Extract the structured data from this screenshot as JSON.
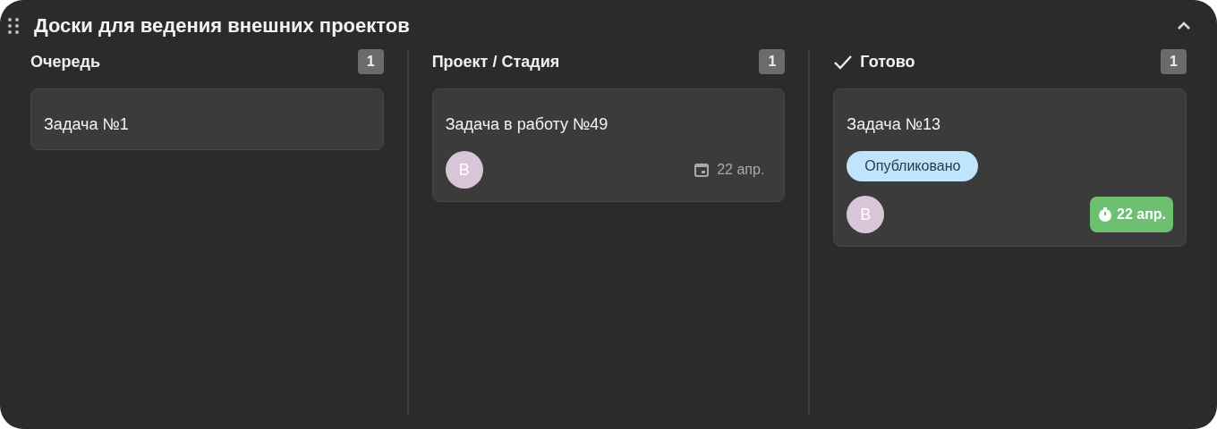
{
  "panel": {
    "title": "Доски для ведения внешних проектов",
    "collapsed": false
  },
  "columns": [
    {
      "title": "Очередь",
      "done": false,
      "count": "1",
      "cards": [
        {
          "title": "Задача №1"
        }
      ]
    },
    {
      "title": "Проект / Стадия",
      "done": false,
      "count": "1",
      "cards": [
        {
          "title": "Задача в работу №49",
          "avatar": "В",
          "due": {
            "kind": "plain",
            "text": "22 апр."
          }
        }
      ]
    },
    {
      "title": "Готово",
      "done": true,
      "count": "1",
      "cards": [
        {
          "title": "Задача №13",
          "tag": "Опубликовано",
          "avatar": "В",
          "due": {
            "kind": "completed",
            "text": "22 апр."
          }
        }
      ]
    }
  ]
}
